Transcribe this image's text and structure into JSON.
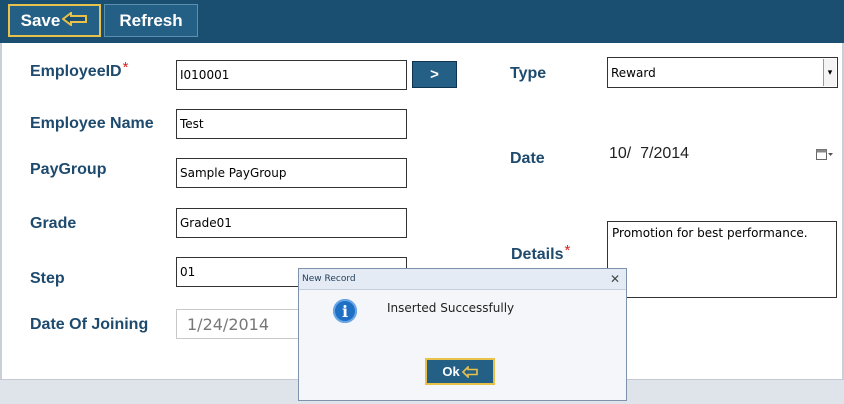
{
  "toolbar": {
    "save_label": "Save",
    "refresh_label": "Refresh"
  },
  "form": {
    "employee_id": {
      "label": "EmployeeID",
      "required_mark": "*",
      "value": "I010001",
      "lookup_button": ">"
    },
    "employee_name": {
      "label": "Employee Name",
      "value": "Test"
    },
    "paygroup": {
      "label": "PayGroup",
      "value": "Sample PayGroup"
    },
    "grade": {
      "label": "Grade",
      "value": "Grade01"
    },
    "step": {
      "label": "Step",
      "value": "01"
    },
    "date_of_joining": {
      "label": "Date Of Joining",
      "value": "1/24/2014"
    },
    "type": {
      "label": "Type",
      "value": "Reward"
    },
    "date": {
      "label": "Date",
      "value": "10/  7/2014"
    },
    "details": {
      "label": "Details",
      "required_mark": "*",
      "value": "Promotion for best performance."
    }
  },
  "dialog": {
    "title": "New Record",
    "close_glyph": "✕",
    "message": "Inserted Successfully",
    "info_glyph": "i",
    "ok_label": "Ok"
  },
  "icons": {
    "pointer": "pointing-hand-icon",
    "calendar": "calendar-icon",
    "dropdown": "chevron-down-icon",
    "info": "info-icon"
  },
  "colors": {
    "toolbar_bg": "#1a4f72",
    "button_bg": "#245f86",
    "label": "#1e4a6e",
    "required": "#d52222",
    "highlight": "#e8c14a"
  }
}
